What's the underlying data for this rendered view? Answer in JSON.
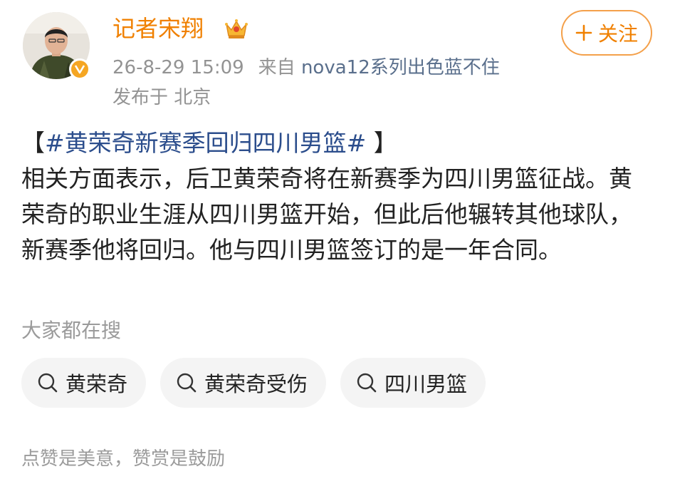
{
  "author": {
    "name": "记者宋翔",
    "crown_icon": "crown-icon",
    "verified_icon": "verified-v-icon"
  },
  "meta": {
    "timestamp": "26-8-29 15:09",
    "source_prefix": "来自",
    "device": "nova12系列出色蓝不住",
    "location": "发布于 北京"
  },
  "follow": {
    "icon": "plus-icon",
    "label": "关注"
  },
  "post": {
    "topic_open": "【",
    "topic": "#黄荣奇新赛季回归四川男篮#",
    "topic_close": " 】",
    "body": "相关方面表示，后卫黄荣奇将在新赛季为四川男篮征战。黄荣奇的职业生涯从四川男篮开始，但此后他辗转其他球队，新赛季他将回归。他与四川男篮签订的是一年合同。"
  },
  "search": {
    "title": "大家都在搜",
    "chips": [
      {
        "label": "黄荣奇",
        "icon": "search-icon"
      },
      {
        "label": "黄荣奇受伤",
        "icon": "search-icon"
      },
      {
        "label": "四川男篮",
        "icon": "search-icon"
      }
    ]
  },
  "footer": {
    "text": "点赞是美意，赞赏是鼓励"
  },
  "colors": {
    "username": "#f08000",
    "topic": "#2b4d8c",
    "muted": "#939393",
    "follow_border": "#f4a04a"
  }
}
